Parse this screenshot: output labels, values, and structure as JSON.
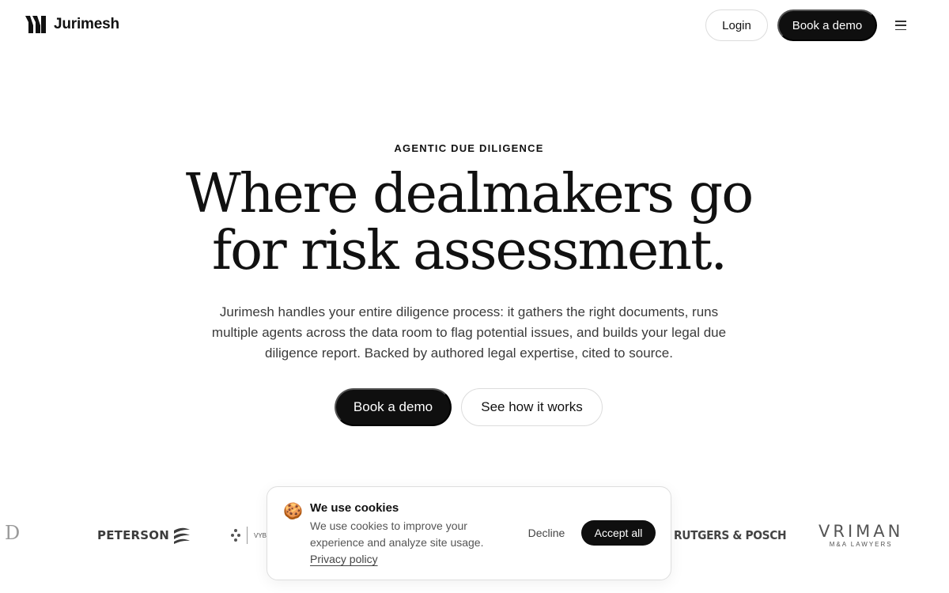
{
  "header": {
    "brand": "Jurimesh",
    "login_label": "Login",
    "demo_label": "Book a demo",
    "menu_icon": "hamburger-menu-icon"
  },
  "hero": {
    "eyebrow": "AGENTIC DUE DILIGENCE",
    "headline_line1": "Where dealmakers go",
    "headline_line2": "for risk assessment.",
    "subtext": "Jurimesh handles your entire diligence process: it gathers the right documents, runs multiple agents across the data room to flag potential issues, and builds your legal due diligence report. Backed by authored legal expertise, cited to source.",
    "primary_cta": "Book a demo",
    "secondary_cta": "See how it works"
  },
  "client_logos": {
    "d": "D",
    "peterson": "PETERSON",
    "vybr": "VYBI",
    "rutgers": "RUTGERS & POSCH",
    "vriman": "VRIMAN",
    "vriman_sub": "M&A LAWYERS"
  },
  "cookie_banner": {
    "icon": "cookie-icon",
    "title": "We use cookies",
    "body": "We use cookies to improve your experience and analyze site usage.",
    "privacy_link": "Privacy policy",
    "decline_label": "Decline",
    "accept_label": "Accept all"
  },
  "colors": {
    "primary": "#0f0f0f",
    "text": "#111111",
    "muted": "#555555",
    "border": "#dcdcdc",
    "background": "#ffffff"
  }
}
